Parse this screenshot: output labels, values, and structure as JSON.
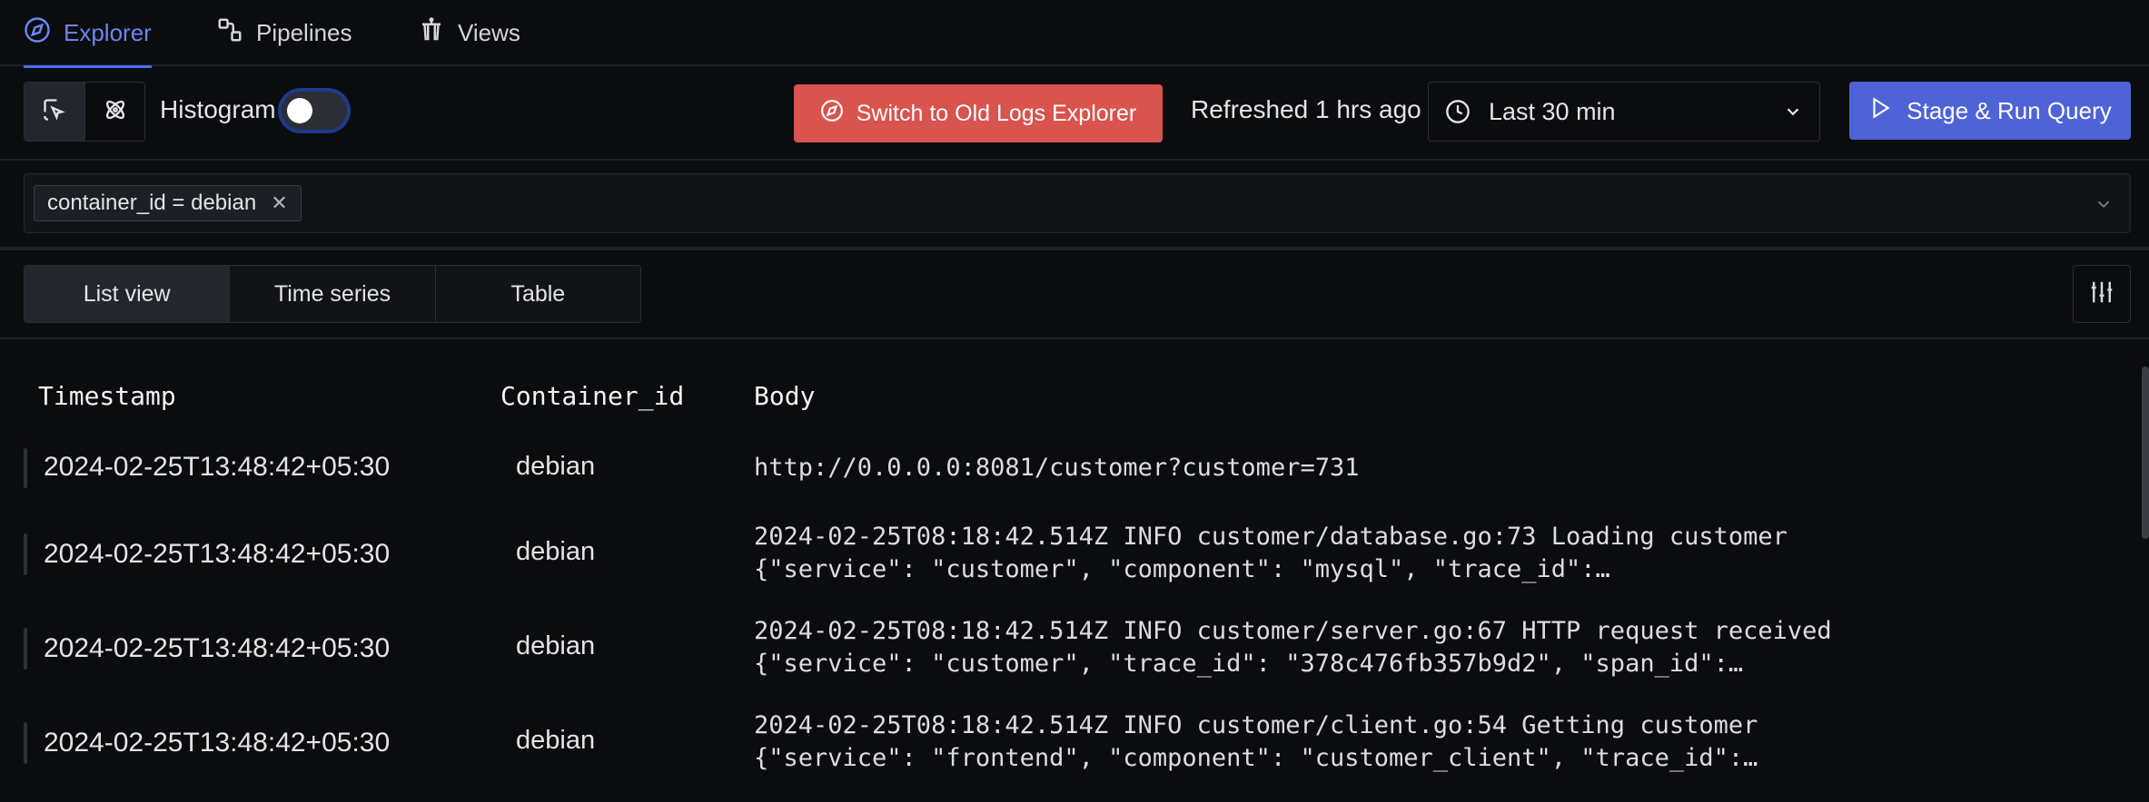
{
  "nav": {
    "tabs": [
      {
        "label": "Explorer",
        "icon": "compass-icon",
        "active": true
      },
      {
        "label": "Pipelines",
        "icon": "pipeline-icon",
        "active": false
      },
      {
        "label": "Views",
        "icon": "views-icon",
        "active": false
      }
    ]
  },
  "toolbar": {
    "histogram_label": "Histogram",
    "histogram_on": false,
    "old_explorer_label": "Switch to Old Logs Explorer",
    "refreshed_text": "Refreshed 1 hrs ago",
    "time_range": "Last 30 min",
    "run_label": "Stage & Run Query"
  },
  "query": {
    "filters": [
      {
        "label": "container_id = debian"
      }
    ]
  },
  "views": {
    "tabs": [
      {
        "label": "List view",
        "active": true
      },
      {
        "label": "Time series",
        "active": false
      },
      {
        "label": "Table",
        "active": false
      }
    ]
  },
  "table": {
    "headers": [
      "Timestamp",
      "Container_id",
      "Body"
    ],
    "rows": [
      {
        "timestamp": "2024-02-25T13:48:42+05:30",
        "container_id": "debian",
        "body_line1": "http://0.0.0.0:8081/customer?customer=731",
        "body_line2": ""
      },
      {
        "timestamp": "2024-02-25T13:48:42+05:30",
        "container_id": "debian",
        "body_line1": "2024-02-25T08:18:42.514Z INFO customer/database.go:73 Loading customer",
        "body_line2": "{\"service\": \"customer\", \"component\": \"mysql\", \"trace_id\":…"
      },
      {
        "timestamp": "2024-02-25T13:48:42+05:30",
        "container_id": "debian",
        "body_line1": "2024-02-25T08:18:42.514Z INFO customer/server.go:67 HTTP request received",
        "body_line2": "{\"service\": \"customer\", \"trace_id\": \"378c476fb357b9d2\", \"span_id\":…"
      },
      {
        "timestamp": "2024-02-25T13:48:42+05:30",
        "container_id": "debian",
        "body_line1": "2024-02-25T08:18:42.514Z INFO customer/client.go:54 Getting customer",
        "body_line2": "{\"service\": \"frontend\", \"component\": \"customer_client\", \"trace_id\":…"
      }
    ]
  }
}
